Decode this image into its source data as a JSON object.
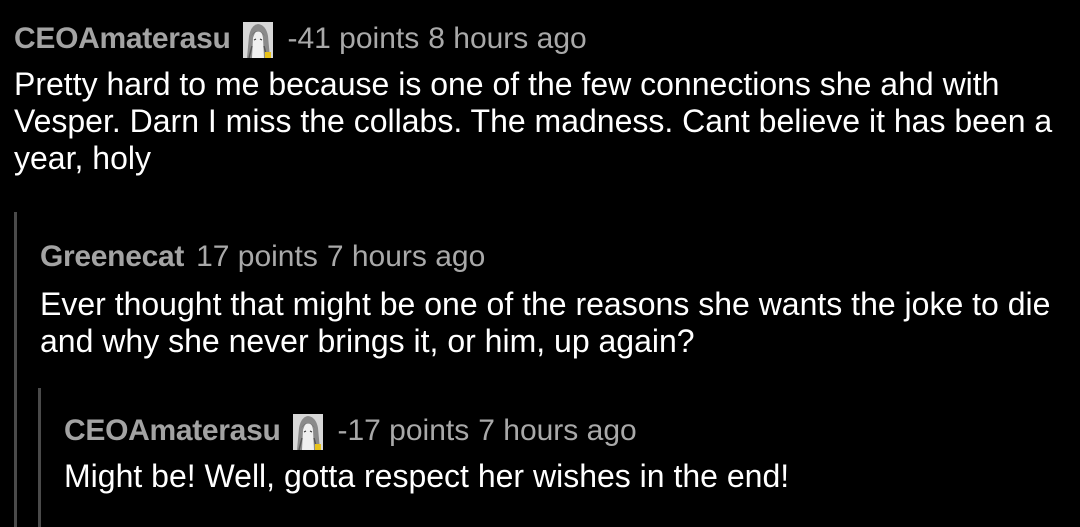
{
  "comments": [
    {
      "username": "CEOAmaterasu",
      "has_flair": true,
      "flair_icon": "anime-avatar-flair-icon",
      "points": "-41 points",
      "time": "8 hours ago",
      "body": "Pretty hard to me because is one of the few connections she ahd with Vesper. Darn I miss the collabs. The madness. Cant believe it has been a year, holy"
    },
    {
      "username": "Greenecat",
      "has_flair": false,
      "points": "17 points",
      "time": "7 hours ago",
      "body": "Ever thought that might be one of the reasons she wants the joke to die and why she never brings it, or him, up again?"
    },
    {
      "username": "CEOAmaterasu",
      "has_flair": true,
      "flair_icon": "anime-avatar-flair-icon",
      "points": "-17 points",
      "time": "7 hours ago",
      "body": "Might be! Well, gotta respect her wishes in the end!"
    }
  ],
  "colors": {
    "background": "#000000",
    "username": "#a3a3a3",
    "meta": "#a9a9a9",
    "body_text": "#ffffff",
    "thread_line": "#4a4a4a"
  }
}
